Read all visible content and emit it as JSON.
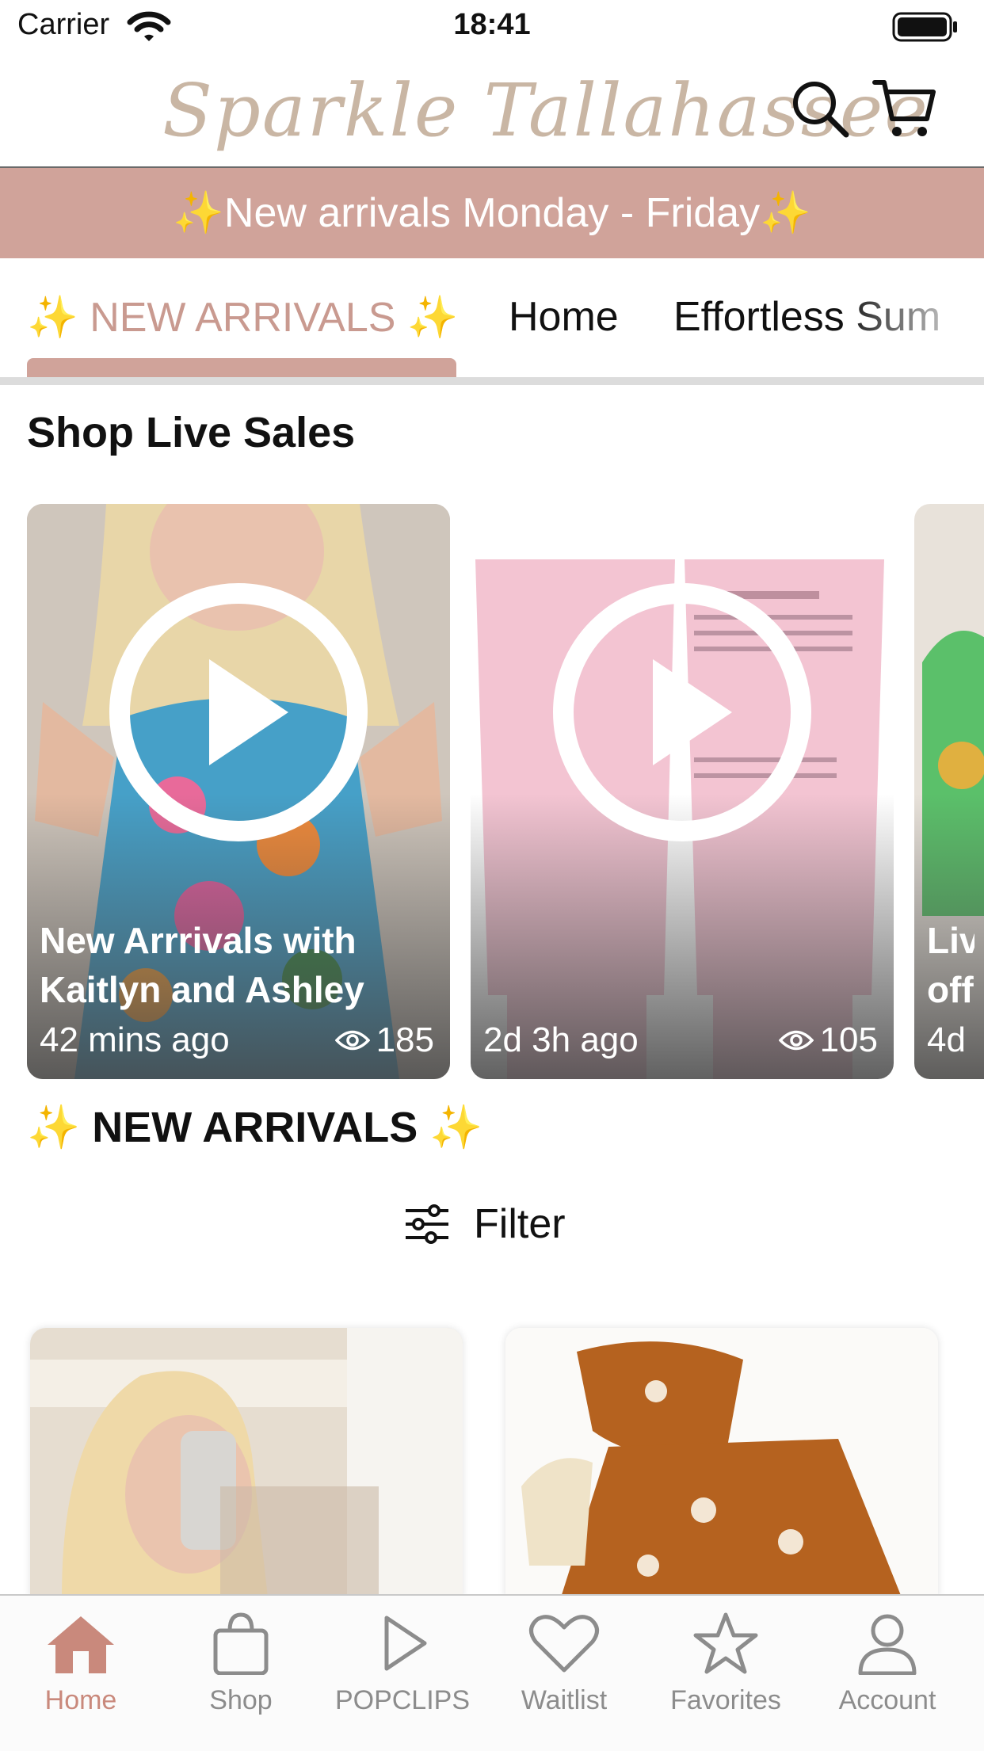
{
  "status_bar": {
    "carrier": "Carrier",
    "time": "18:41"
  },
  "header": {
    "logo_text": "Sparkle Tallahassee",
    "search_icon": "search-icon",
    "cart_icon": "cart-icon"
  },
  "promo": {
    "text": "✨New arrivals Monday - Friday✨"
  },
  "tabs": [
    {
      "label": "✨ NEW ARRIVALS ✨",
      "active": true
    },
    {
      "label": "Home",
      "active": false
    },
    {
      "label": "Effortless Sum",
      "active": false
    }
  ],
  "live_sales": {
    "title": "Shop Live Sales",
    "cards": [
      {
        "title": "New Arrrivals with Kaitlyn and Ashley",
        "time": "42 mins ago",
        "views": "185"
      },
      {
        "title": "",
        "time": "2d 3h ago",
        "views": "105"
      },
      {
        "title": "Liv off",
        "time": "4d",
        "views": ""
      }
    ]
  },
  "new_arrivals": {
    "sparkle_left": "✨",
    "title": "NEW ARRIVALS",
    "sparkle_right": "✨"
  },
  "filter": {
    "label": "Filter",
    "icon": "sliders-icon"
  },
  "tab_bar": [
    {
      "label": "Home",
      "icon": "house-icon",
      "active": true
    },
    {
      "label": "Shop",
      "icon": "bag-icon",
      "active": false
    },
    {
      "label": "POPCLIPS",
      "icon": "play-icon",
      "active": false
    },
    {
      "label": "Waitlist",
      "icon": "heart-icon",
      "active": false
    },
    {
      "label": "Favorites",
      "icon": "star-icon",
      "active": false
    },
    {
      "label": "Account",
      "icon": "person-icon",
      "active": false
    }
  ],
  "colors": {
    "accent": "#d0a39a",
    "accent_text": "#c9897c",
    "logo": "#c9b6a4"
  }
}
